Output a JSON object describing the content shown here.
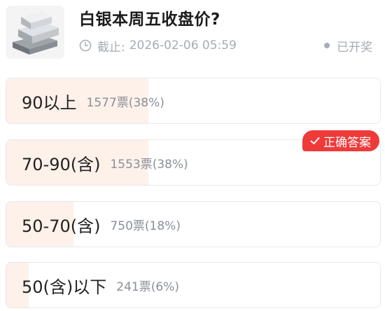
{
  "poll": {
    "title": "白银本周五收盘价?",
    "deadline_label": "截止:",
    "deadline_value": "2026-02-06 05:59",
    "status": "已开奖",
    "thumbnail_icon": "silver-bars-icon"
  },
  "options": [
    {
      "label": "90以上",
      "stats": "1577票(38%)",
      "share": 0.38
    },
    {
      "label": "70-90(含)",
      "stats": "1553票(38%)",
      "share": 0.38,
      "correct": true
    },
    {
      "label": "50-70(含)",
      "stats": "750票(18%)",
      "share": 0.18
    },
    {
      "label": "50(含)以下",
      "stats": "241票(6%)",
      "share": 0.06
    }
  ],
  "badge": {
    "label": "正确答案",
    "icon": "checkmark-icon"
  },
  "colors": {
    "accent": "#ef3a3a",
    "fill": "#fdf1ea",
    "muted": "#a7acb4",
    "border": "#e6e8ec"
  }
}
